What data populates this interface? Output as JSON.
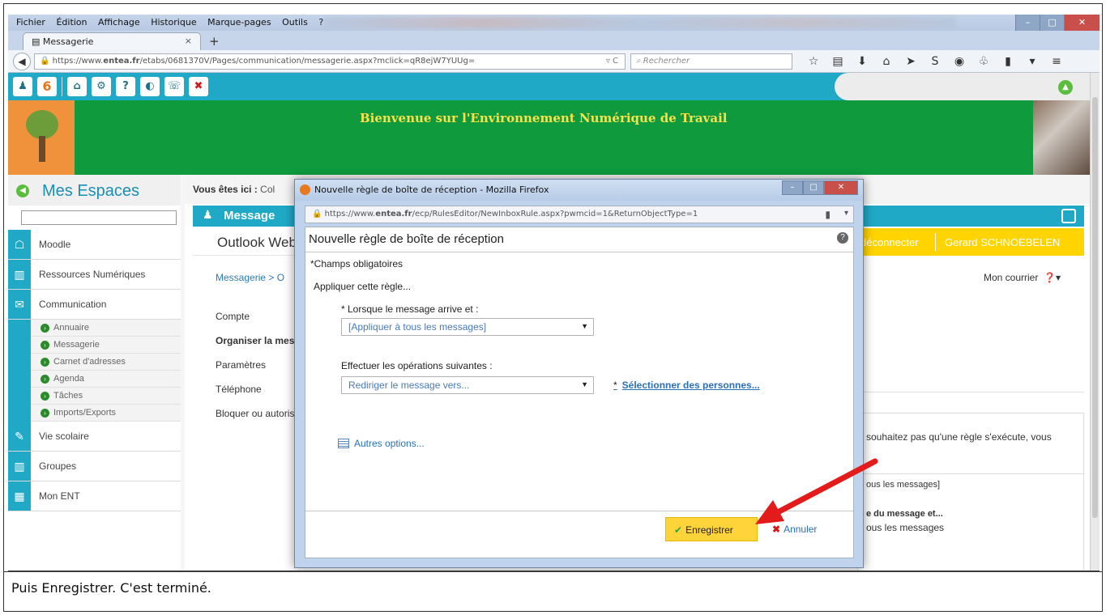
{
  "browser": {
    "menu": [
      "Fichier",
      "Édition",
      "Affichage",
      "Historique",
      "Marque-pages",
      "Outils",
      "?"
    ],
    "tab_title": "Messagerie",
    "tab_close": "×",
    "new_tab": "+",
    "url_prefix": "https://www.",
    "url_domain": "entea.fr",
    "url_path": "/etabs/0681370V/Pages/communication/messagerie.aspx?mclick=qR8ejW7YUUg=",
    "search_placeholder": "Rechercher"
  },
  "ent": {
    "notification_count": "6",
    "banner_line1": "Bienvenue sur l'Environnement Numérique de Travail",
    "sidebar_title": "Mes Espaces",
    "sidebar_items": [
      {
        "label": "Moodle"
      },
      {
        "label": "Ressources Numériques"
      },
      {
        "label": "Communication"
      }
    ],
    "sidebar_subitems": [
      {
        "label": "Annuaire"
      },
      {
        "label": "Messagerie"
      },
      {
        "label": "Carnet d'adresses"
      },
      {
        "label": "Agenda"
      },
      {
        "label": "Tâches"
      },
      {
        "label": "Imports/Exports"
      }
    ],
    "sidebar_bottom": [
      {
        "label": "Vie scolaire"
      },
      {
        "label": "Groupes"
      },
      {
        "label": "Mon ENT"
      }
    ],
    "breadcrumb_label": "Vous êtes ici :",
    "breadcrumb_value": "Col",
    "panel_title": "Message",
    "owa_logo": "Outlook Web A",
    "disconnect": "déconnecter",
    "user_name": "Gerard SCHNOEBELEN",
    "crumb2": "Messagerie  >  O",
    "mon_courrier": "Mon courrier",
    "left_nav": [
      {
        "label": "Compte",
        "bold": false
      },
      {
        "label": "Organiser la messag",
        "bold": true
      },
      {
        "label": "Paramètres",
        "bold": false
      },
      {
        "label": "Téléphone",
        "bold": false
      },
      {
        "label": "Bloquer ou autoris",
        "bold": false
      }
    ],
    "right_p1": "souhaitez pas qu'une règle s'exécute, vous",
    "right_p2": "ous les messages]",
    "right_p3": "e du message et...",
    "right_p4": "ous les messages"
  },
  "dialog": {
    "window_title": "Nouvelle règle de boîte de réception - Mozilla Firefox",
    "url_prefix": "https://www.",
    "url_domain": "entea.fr",
    "url_path": "/ecp/RulesEditor/NewInboxRule.aspx?pwmcid=1&ReturnObjectType=1",
    "heading": "Nouvelle règle de boîte de réception",
    "required_note": "*Champs obligatoires",
    "apply_label": "Appliquer cette règle...",
    "when_label": "* Lorsque le message arrive et :",
    "when_value": "[Appliquer à tous les messages]",
    "ops_label": "Effectuer les opérations suivantes :",
    "ops_value": "Rediriger le message vers...",
    "select_people_star": "*",
    "select_people": "Sélectionner des personnes...",
    "more_options": "Autres options...",
    "save_label": "Enregistrer",
    "cancel_label": "Annuler"
  },
  "caption": "Puis Enregistrer. C'est terminé.",
  "colors": {
    "accent_teal": "#1fa9c6",
    "banner_green": "#0f9a3e",
    "save_yellow": "#ffd43b",
    "arrow_red": "#e41b1b"
  }
}
